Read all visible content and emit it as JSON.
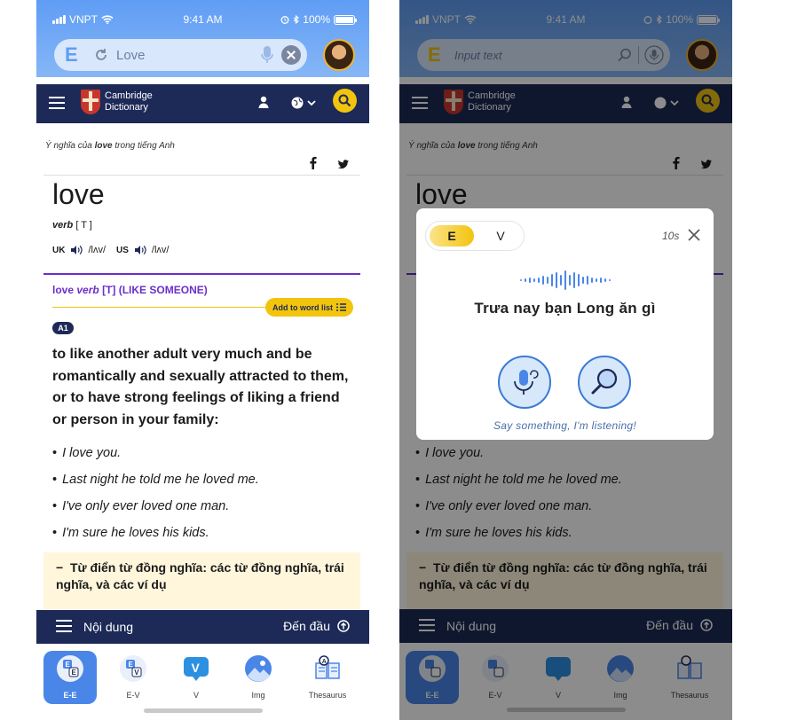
{
  "status": {
    "carrier": "VNPT",
    "time": "9:41 AM",
    "battery": "100%"
  },
  "search": {
    "logo": "E",
    "query": "Love",
    "placeholder": "Input text"
  },
  "cambridge": {
    "brand_line1": "Cambridge",
    "brand_line2": "Dictionary"
  },
  "entry": {
    "meaning_prefix": "Ý nghĩa của ",
    "meaning_word": "love",
    "meaning_suffix": " trong tiếng Anh",
    "headword": "love",
    "pos": "verb",
    "grammar": "[ T ]",
    "uk_label": "UK",
    "uk_ipa": "/lʌv/",
    "us_label": "US",
    "us_ipa": "/lʌv/",
    "sense_word": "love",
    "sense_pos": "verb",
    "sense_grammar": "[T]",
    "sense_guide": "(LIKE SOMEONE)",
    "add_to_list": "Add to word list",
    "level": "A1",
    "definition": "to like another adult very much and be romantically and sexually attracted to them, or to have strong feelings of liking a friend or person in your family:",
    "examples": [
      "I love you.",
      "Last night he told me he loved me.",
      "I've only ever loved one man.",
      "I'm sure he loves his kids."
    ],
    "thesaurus": "Từ điển từ đồng nghĩa: các từ đồng nghĩa, trái nghĩa, và các ví dụ"
  },
  "content_bar": {
    "label": "Nội dung",
    "to_top": "Đến đầu"
  },
  "tabs": [
    {
      "label": "E-E",
      "icon": "ee-icon",
      "active": true
    },
    {
      "label": "E-V",
      "icon": "ev-icon",
      "active": false
    },
    {
      "label": "V",
      "icon": "v-icon",
      "active": false
    },
    {
      "label": "Img",
      "icon": "image-icon",
      "active": false
    },
    {
      "label": "Thesaurus",
      "icon": "thesaurus-icon",
      "active": false
    }
  ],
  "voice_modal": {
    "lang_e": "E",
    "lang_v": "V",
    "countdown": "10s",
    "transcript": "Trưa nay bạn Long ăn gì",
    "hint": "Say something, I'm listening!"
  },
  "colors": {
    "navy": "#1d2a57",
    "yellow": "#f2c40d",
    "purple": "#6b2fc9",
    "blue": "#4a86e8",
    "thesaurus_bg": "#fff6dc"
  }
}
